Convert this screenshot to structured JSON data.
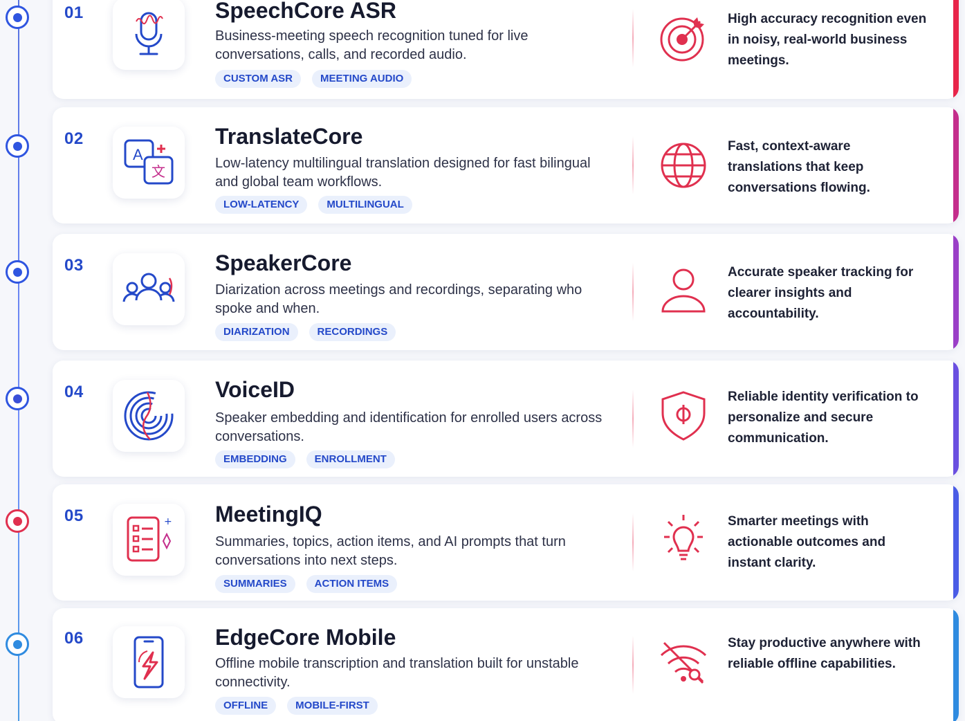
{
  "colors": {
    "primary": "#2449c9",
    "accent_red": "#e0304f",
    "tag_bg": "#eaf0fc",
    "card_accents": [
      "#e8254a",
      "#c42e8c",
      "#9a3fc7",
      "#6a4fe0",
      "#4a5ce6",
      "#2f8be0"
    ],
    "dot_fills": [
      "#2f55e0",
      "#2f55e0",
      "#2f55e0",
      "#3a4fd8",
      "#e0304f",
      "#2f8be0"
    ]
  },
  "items": [
    {
      "number": "01",
      "title": "SpeechCore ASR",
      "description": "Business-meeting speech recognition tuned for live conversations, calls, and recorded audio.",
      "tags": [
        "CUSTOM ASR",
        "MEETING AUDIO"
      ],
      "product_icon": "microphone-icon",
      "benefit_icon": "target-icon",
      "benefit": "High accuracy recognition even in noisy, real-world business meetings."
    },
    {
      "number": "02",
      "title": "TranslateCore",
      "description": "Low-latency multilingual translation designed for fast bilingual and global team workflows.",
      "tags": [
        "LOW-LATENCY",
        "MULTILINGUAL"
      ],
      "product_icon": "translate-icon",
      "benefit_icon": "globe-icon",
      "benefit": "Fast, context-aware translations that keep conversations flowing."
    },
    {
      "number": "03",
      "title": "SpeakerCore",
      "description": "Diarization across meetings and recordings, separating who spoke and when.",
      "tags": [
        "DIARIZATION",
        "RECORDINGS"
      ],
      "product_icon": "group-icon",
      "benefit_icon": "person-icon",
      "benefit": "Accurate speaker tracking for clearer insights and accountability."
    },
    {
      "number": "04",
      "title": "VoiceID",
      "description": "Speaker embedding and identification for enrolled users across conversations.",
      "tags": [
        "EMBEDDING",
        "ENROLLMENT"
      ],
      "product_icon": "fingerprint-icon",
      "benefit_icon": "shield-icon",
      "benefit": "Reliable identity verification to personalize and secure communication."
    },
    {
      "number": "05",
      "title": "MeetingIQ",
      "description": "Summaries, topics, action items, and AI prompts that turn conversations into next steps.",
      "tags": [
        "SUMMARIES",
        "ACTION ITEMS"
      ],
      "product_icon": "checklist-icon",
      "benefit_icon": "lightbulb-icon",
      "benefit": "Smarter meetings with actionable outcomes and instant clarity."
    },
    {
      "number": "06",
      "title": "EdgeCore Mobile",
      "description": "Offline mobile transcription and translation built for unstable connectivity.",
      "tags": [
        "OFFLINE",
        "MOBILE-FIRST"
      ],
      "product_icon": "mobile-icon",
      "benefit_icon": "wifi-off-icon",
      "benefit": "Stay productive anywhere with reliable offline capabilities."
    }
  ]
}
